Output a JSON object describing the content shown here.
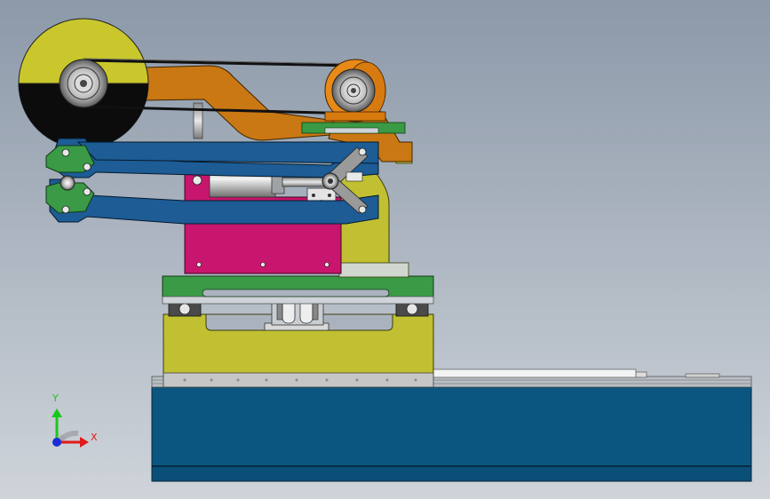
{
  "viewport": {
    "background_top": "#8c99a9",
    "background_bottom": "#cfd4da"
  },
  "triad": {
    "y_label": "Y",
    "x_label": "X",
    "y_color": "#18c81c",
    "x_color": "#e01a1a",
    "z_color": "#1c2bd6"
  },
  "palette": {
    "grinding_wheel": "#c9c72c",
    "grinding_wheel_dark": "#0c0c0c",
    "belt_arm": "#c97814",
    "clamp_arm": "#1d5c95",
    "cylinder_block": "#c8156d",
    "support_plate": "#c0c032",
    "sliding_base": "#c0c032",
    "rail_plate": "#3a9a45",
    "machine_bed": "#0b5680",
    "drive_pulley": "#e88a18",
    "guide_rail": "#c8c8c8"
  }
}
